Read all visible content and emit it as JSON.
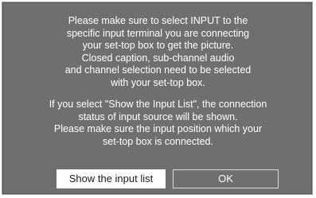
{
  "dialog": {
    "message_1": [
      "Please make sure to select INPUT to the",
      "specific input terminal you are connecting",
      "your set-top box to get the picture.",
      "Closed caption, sub-channel audio",
      "and channel selection need to be selected",
      "with your set-top box."
    ],
    "message_2": [
      "If you select \"Show the Input List\", the connection",
      "status of input source will be shown.",
      "Please make sure the input position which your",
      "set-top box is connected."
    ],
    "buttons": {
      "show_input_list": "Show the input list",
      "ok": "OK"
    }
  },
  "colors": {
    "dialog_background": "#6f6f6f",
    "text": "#ffffff",
    "selected_button_background": "#ffffff",
    "selected_button_text": "#1a1a1a"
  }
}
